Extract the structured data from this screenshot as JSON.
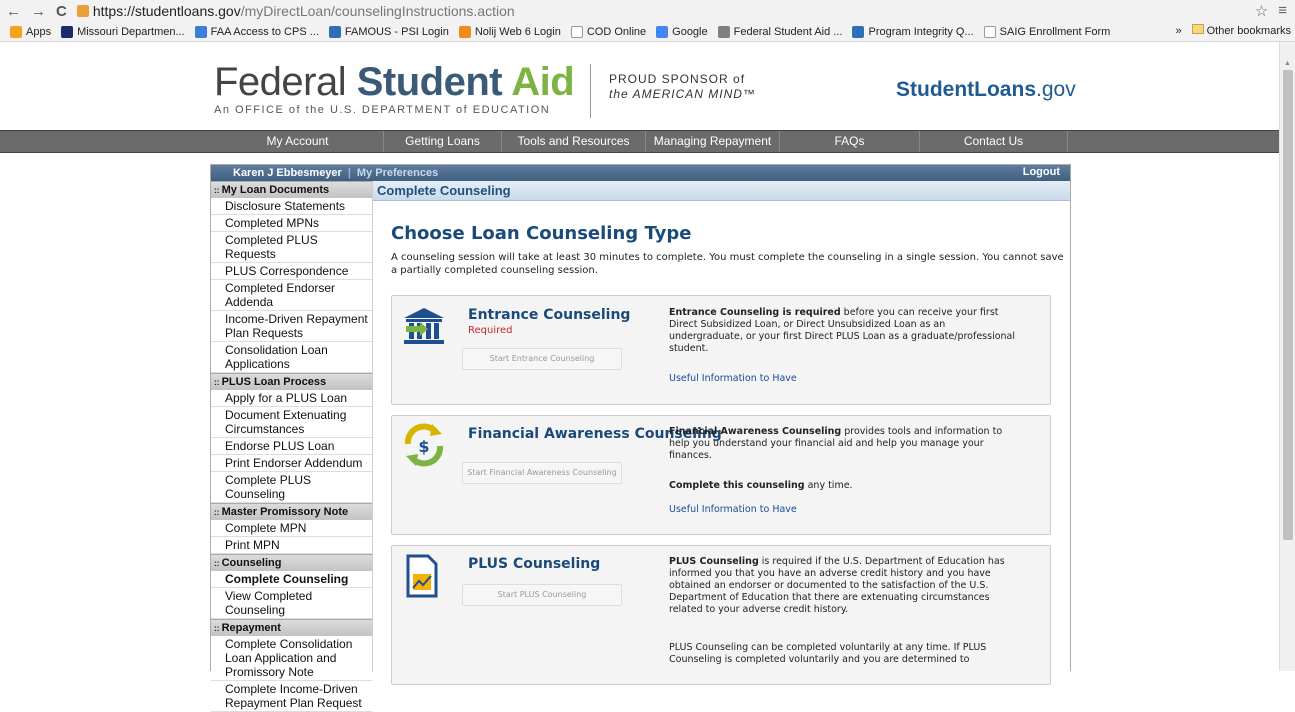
{
  "browser": {
    "url_host": "https://studentloans.gov",
    "url_path": "/myDirectLoan/counselingInstructions.action",
    "back": "←",
    "forward": "→",
    "reload": "C",
    "star": "☆",
    "menu": "≡"
  },
  "bookmarks": [
    {
      "label": "Apps",
      "color": "#f3a517"
    },
    {
      "label": "Missouri Departmen...",
      "color": "#1a2a6b"
    },
    {
      "label": "FAA Access to CPS ...",
      "color": "#3b7dd8"
    },
    {
      "label": "FAMOUS - PSI Login",
      "color": "#2f6fb6"
    },
    {
      "label": "Nolij Web 6 Login",
      "color": "#f08a1c"
    },
    {
      "label": "COD Online",
      "color": "#ffffff"
    },
    {
      "label": "Google",
      "color": "#4285f4"
    },
    {
      "label": "Federal Student Aid ...",
      "color": "#808080"
    },
    {
      "label": "Program Integrity Q...",
      "color": "#2f6fb6"
    },
    {
      "label": "SAIG Enrollment Form",
      "color": "#ffffff"
    }
  ],
  "bookmarks_more": "»",
  "bookmarks_other": "Other bookmarks",
  "header": {
    "logo_w1": "Federal ",
    "logo_w2": "Student ",
    "logo_w3": "Aid",
    "logo_sub": "An OFFICE of the U.S. DEPARTMENT of EDUCATION",
    "sponsor_l1": "PROUD SPONSOR of",
    "sponsor_l2": "the AMERICAN MIND™",
    "sl_main": "StudentLoans",
    "sl_gov": ".gov"
  },
  "nav": [
    "My Account",
    "Getting Loans",
    "Tools and Resources",
    "Managing Repayment",
    "FAQs",
    "Contact Us"
  ],
  "userbar": {
    "user": "Karen J Ebbesmeyer",
    "sep": "|",
    "prefs": "My Preferences",
    "logout": "Logout"
  },
  "sidebar": [
    {
      "section": "My Loan Documents",
      "items": [
        "Disclosure Statements",
        "Completed MPNs",
        "Completed PLUS Requests",
        "PLUS Correspondence",
        "Completed Endorser Addenda",
        "Income-Driven Repayment Plan Requests",
        "Consolidation Loan Applications"
      ]
    },
    {
      "section": "PLUS Loan Process",
      "items": [
        "Apply for a PLUS Loan",
        "Document Extenuating Circumstances",
        "Endorse PLUS Loan",
        "Print Endorser Addendum",
        "Complete PLUS Counseling"
      ]
    },
    {
      "section": "Master Promissory Note",
      "items": [
        "Complete MPN",
        "Print MPN"
      ]
    },
    {
      "section": "Counseling",
      "items": [
        "Complete Counseling",
        "View Completed Counseling"
      ]
    },
    {
      "section": "Repayment",
      "items": [
        "Complete Consolidation Loan Application and Promissory Note",
        "Complete Income-Driven Repayment Plan Request"
      ]
    }
  ],
  "content": {
    "title": "Complete Counseling",
    "heading": "Choose Loan Counseling Type",
    "intro": "A counseling session will take at least 30 minutes to complete. You must complete the counseling in a single session. You cannot save a partially completed counseling session.",
    "cards": [
      {
        "title": "Entrance Counseling",
        "required": "Required",
        "button": "Start Entrance Counseling",
        "desc_bold": "Entrance Counseling is required",
        "desc_rest": " before you can receive your first Direct Subsidized Loan, or Direct Unsubsidized Loan as an undergraduate, or your first Direct PLUS Loan as a graduate/professional student.",
        "link": "Useful Information to Have"
      },
      {
        "title": "Financial Awareness Counseling",
        "button": "Start Financial Awareness Counseling",
        "desc_bold": "Financial Awareness Counseling",
        "desc_rest": " provides tools and information to help you understand your financial aid and help you manage your finances.",
        "desc2_bold": "Complete this counseling",
        "desc2_rest": " any time.",
        "link": "Useful Information to Have"
      },
      {
        "title": "PLUS Counseling",
        "button": "Start PLUS Counseling",
        "desc_bold": "PLUS Counseling",
        "desc_rest": " is required if the U.S. Department of Education has informed you that you have an adverse credit history and you have obtained an endorser or documented to the satisfaction of the U.S. Department of Education that there are extenuating circumstances related to your adverse credit history.",
        "desc2": "PLUS Counseling can be completed voluntarily at any time. If PLUS Counseling is completed voluntarily and you are determined to"
      }
    ]
  }
}
